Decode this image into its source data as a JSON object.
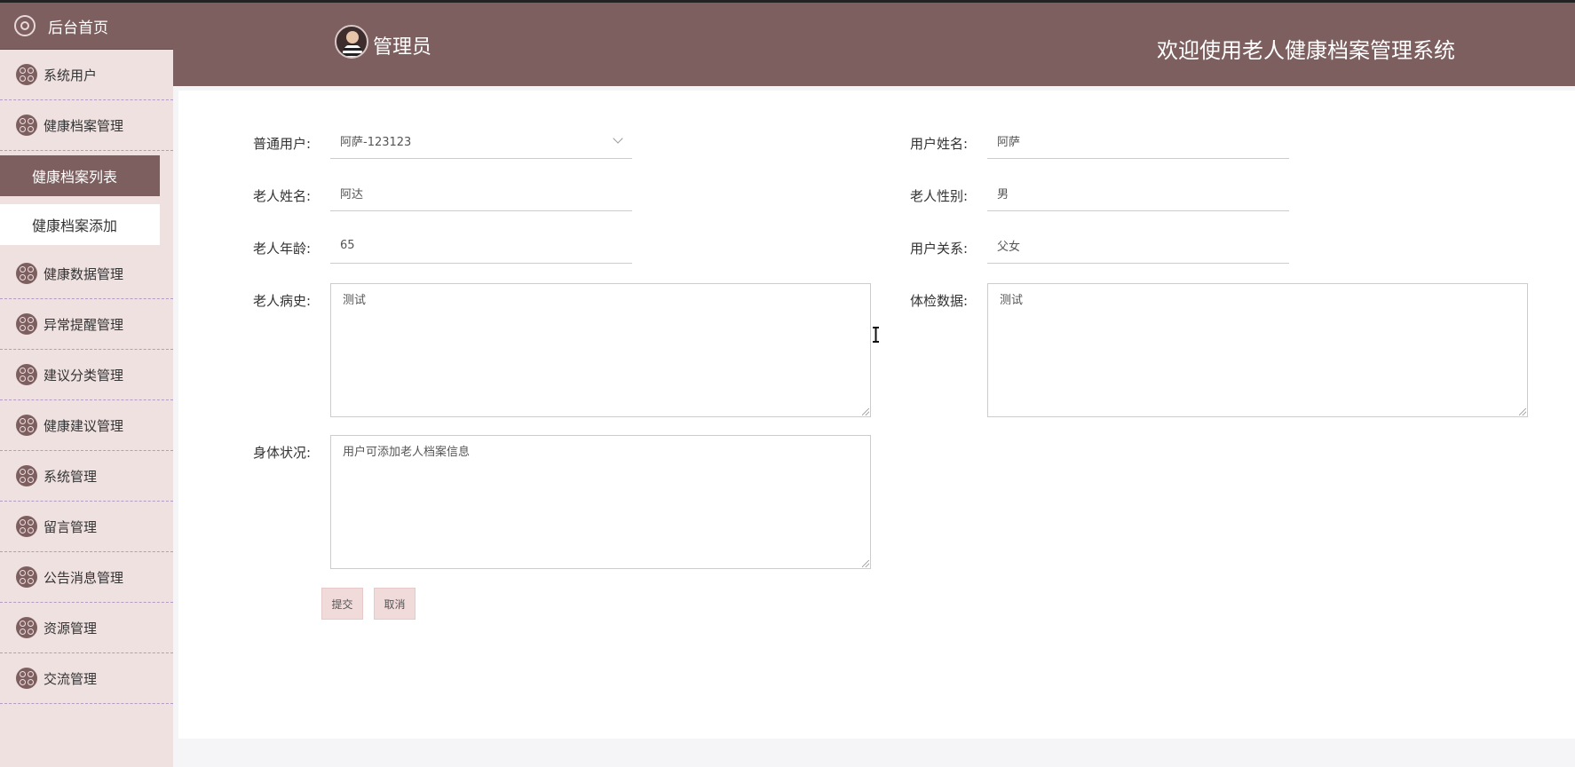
{
  "sidebar": {
    "home_label": "后台首页",
    "items": [
      {
        "label": "系统用户"
      },
      {
        "label": "健康档案管理"
      },
      {
        "label": "健康数据管理"
      },
      {
        "label": "异常提醒管理"
      },
      {
        "label": "建议分类管理"
      },
      {
        "label": "健康建议管理"
      },
      {
        "label": "系统管理"
      },
      {
        "label": "留言管理"
      },
      {
        "label": "公告消息管理"
      },
      {
        "label": "资源管理"
      },
      {
        "label": "交流管理"
      }
    ],
    "subitems": [
      {
        "label": "健康档案列表",
        "active": true
      },
      {
        "label": "健康档案添加",
        "active": false
      }
    ]
  },
  "header": {
    "admin_name": "管理员",
    "welcome": "欢迎使用老人健康档案管理系统"
  },
  "form": {
    "user_label": "普通用户:",
    "user_value": "阿萨-123123",
    "username_label": "用户姓名:",
    "username_value": "阿萨",
    "elder_name_label": "老人姓名:",
    "elder_name_value": "阿达",
    "elder_gender_label": "老人性别:",
    "elder_gender_value": "男",
    "elder_age_label": "老人年龄:",
    "elder_age_value": "65",
    "relation_label": "用户关系:",
    "relation_value": "父女",
    "history_label": "老人病史:",
    "history_value": "测试",
    "checkup_label": "体检数据:",
    "checkup_value": "测试",
    "condition_label": "身体状况:",
    "condition_value": "用户可添加老人档案信息",
    "submit_label": "提交",
    "cancel_label": "取消"
  }
}
